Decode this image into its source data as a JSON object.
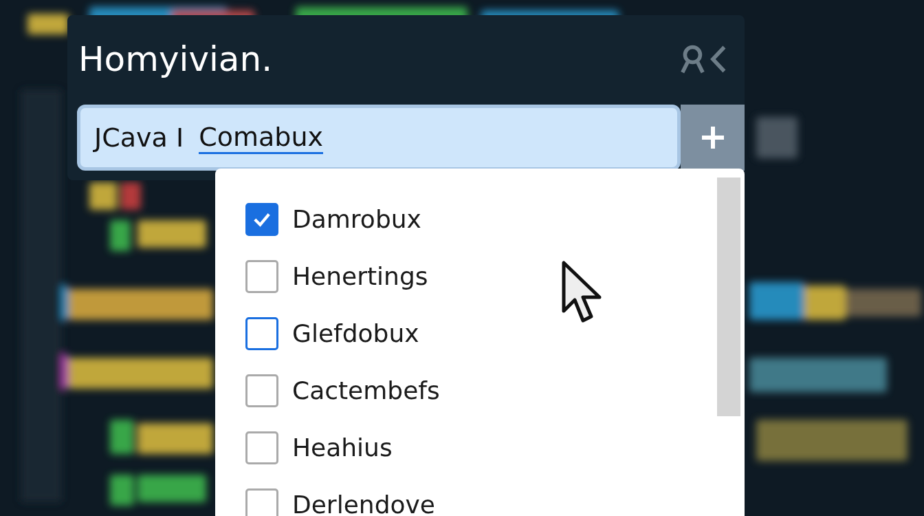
{
  "panel": {
    "title": "Homyivian.",
    "field": {
      "text": "JCava I",
      "underlined": "Comabux"
    }
  },
  "dropdown": {
    "items": [
      {
        "label": "Damrobux",
        "checked": true,
        "focused": false
      },
      {
        "label": "Henertings",
        "checked": false,
        "focused": false
      },
      {
        "label": "Glefdobux",
        "checked": false,
        "focused": true
      },
      {
        "label": "Cactembefs",
        "checked": false,
        "focused": false
      },
      {
        "label": "Heahius",
        "checked": false,
        "focused": false
      },
      {
        "label": "Derlendove",
        "checked": false,
        "focused": false
      }
    ]
  }
}
